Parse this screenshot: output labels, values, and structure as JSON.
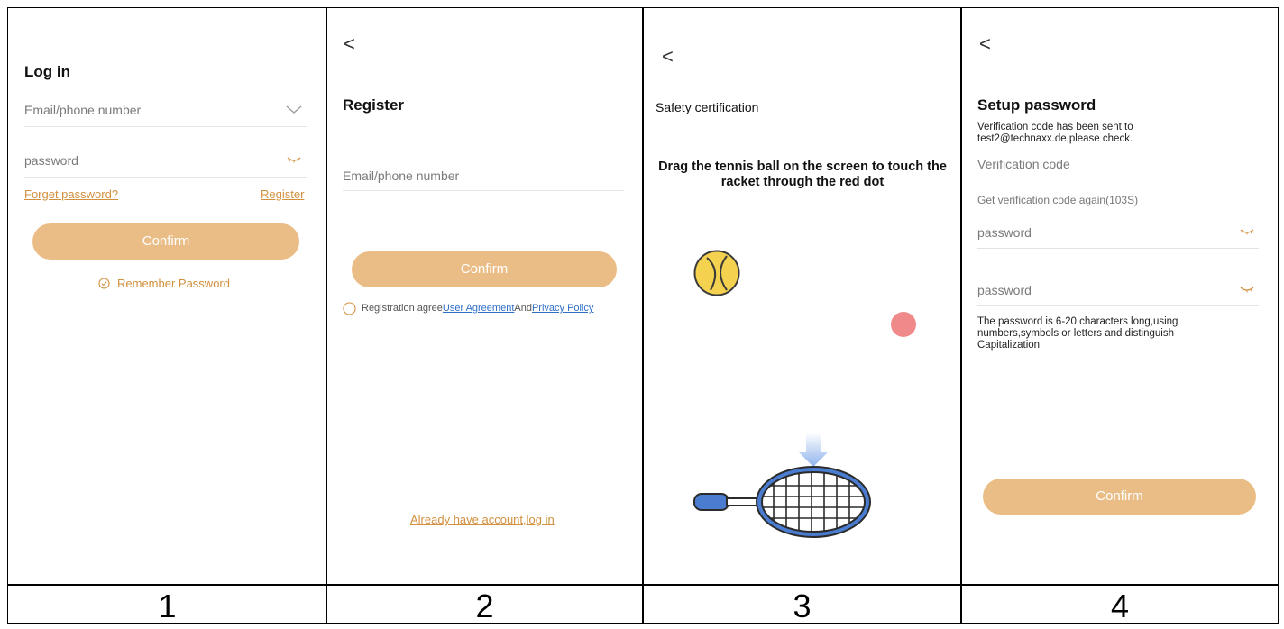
{
  "panels": {
    "p1": {
      "title": "Log in",
      "email_placeholder": "Email/phone number",
      "password_placeholder": "password",
      "forget_password": "Forget password?",
      "register": "Register",
      "confirm": "Confirm",
      "remember_password": "Remember Password"
    },
    "p2": {
      "back": "<",
      "title": "Register",
      "email_placeholder": "Email/phone number",
      "confirm": "Confirm",
      "agree_prefix": "Registration agree",
      "user_agreement": "User Agreement",
      "and": "And",
      "privacy_policy": "Privacy Policy",
      "login_link": "Already have account,log in"
    },
    "p3": {
      "back": "<",
      "title": "Safety certification",
      "instruction": "Drag the tennis ball on the screen to touch the racket through the red dot"
    },
    "p4": {
      "back": "<",
      "title": "Setup password",
      "sent_info": "Verification code has been sent to test2@technaxx.de,please check.",
      "verification_placeholder": "Verification code",
      "resend": "Get verification code again(103S)",
      "password1_placeholder": "password",
      "password2_placeholder": "password",
      "hint": "The password is 6-20 characters long,using numbers,symbols or letters and distinguish Capitalization",
      "confirm": "Confirm"
    }
  },
  "labels": [
    "1",
    "2",
    "3",
    "4"
  ],
  "colors": {
    "accent": "#ebbd86",
    "link_orange": "#d2903f",
    "link_blue": "#2f6fc8",
    "ball": "#f4d24f",
    "red_dot": "#f08a8a",
    "racket": "#2b5aa8"
  }
}
